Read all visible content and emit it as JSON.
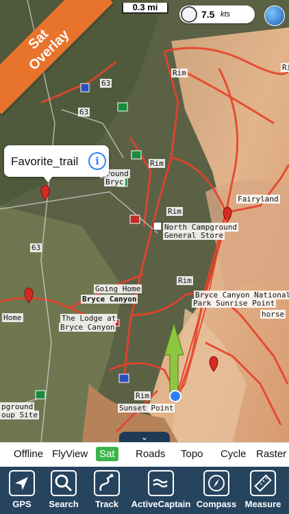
{
  "ribbon": {
    "line1": "Sat",
    "line2": "Overlay"
  },
  "scale": {
    "label": "0.3 mi"
  },
  "speed": {
    "value": "7.5",
    "unit": "kts"
  },
  "callout": {
    "title": "Favorite_trail",
    "info_glyph": "i"
  },
  "map_labels": {
    "rim1": "Rim",
    "rim2": "Rim",
    "rim3": "Rim",
    "rim4": "Rim",
    "rim5": "Rim",
    "rim6": "Rim",
    "fairyland": "Fairyland",
    "north_campground": "North Campground",
    "general_store": "General Store",
    "going_home": "Going Home",
    "bryce_canyon": "Bryce Canyon",
    "bryce_np": "Bryce Canyon National",
    "sunrise_point": "Park Sunrise Point",
    "lodge1": "The Lodge at",
    "lodge2": "Bryce Canyon",
    "home": "Home",
    "horse": "horse",
    "sunset_point": "Sunset Point",
    "campground": "pground",
    "group_site": "oup Site",
    "route63a": "63",
    "route63b": "63",
    "route63c": "63",
    "bryce_partial": "Bryc",
    "ground_partial": "ground"
  },
  "layers": [
    {
      "label": "Offline",
      "active": false
    },
    {
      "label": "FlyView",
      "active": false
    },
    {
      "label": "Sat",
      "active": true
    },
    {
      "label": "Roads",
      "active": false
    },
    {
      "label": "Topo",
      "active": false
    },
    {
      "label": "Cycle",
      "active": false
    },
    {
      "label": "Raster",
      "active": false
    }
  ],
  "tools": [
    {
      "label": "GPS",
      "icon": "gps-arrow-icon"
    },
    {
      "label": "Search",
      "icon": "search-icon"
    },
    {
      "label": "Track",
      "icon": "track-icon"
    },
    {
      "label": "ActiveCaptain",
      "icon": "activecaptain-icon"
    },
    {
      "label": "Compass",
      "icon": "compass-icon"
    },
    {
      "label": "Measure",
      "icon": "ruler-icon"
    }
  ],
  "colors": {
    "accent_orange": "#e8732b",
    "toolbar_bg": "#27445f",
    "sat_active": "#3bb54a",
    "trail_red": "#e8412a"
  }
}
